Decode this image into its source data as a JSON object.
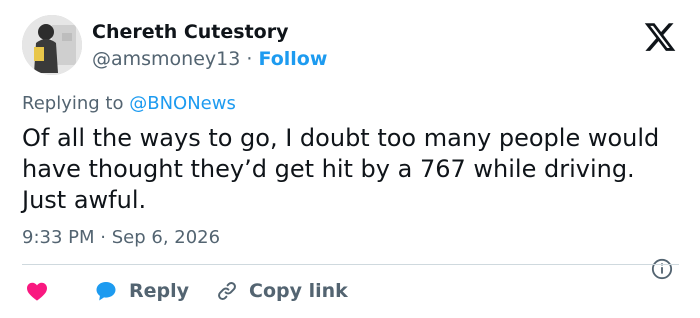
{
  "author": {
    "name": "Chereth Cutestory",
    "handle": "@amsmoney13",
    "separator": "·",
    "follow_label": "Follow"
  },
  "reply_context": {
    "prefix": "Replying to",
    "mention": "@BNONews"
  },
  "tweet": {
    "text": "Of all the ways to go, I doubt too many people would have thought they’d get hit by a 767 while driving. Just awful.",
    "time": "9:33 PM",
    "date_separator": "·",
    "date": "Sep 6, 2026"
  },
  "actions": {
    "reply_label": "Reply",
    "copy_link_label": "Copy link"
  },
  "icons": {
    "logo": "x-logo",
    "info": "info-icon",
    "like": "heart-icon",
    "reply": "reply-bubble-icon",
    "copy": "link-icon"
  },
  "colors": {
    "accent": "#1d9bf0",
    "like": "#f91880",
    "secondary_text": "#536471",
    "primary_text": "#0f1419",
    "divider": "#cfd9de"
  }
}
